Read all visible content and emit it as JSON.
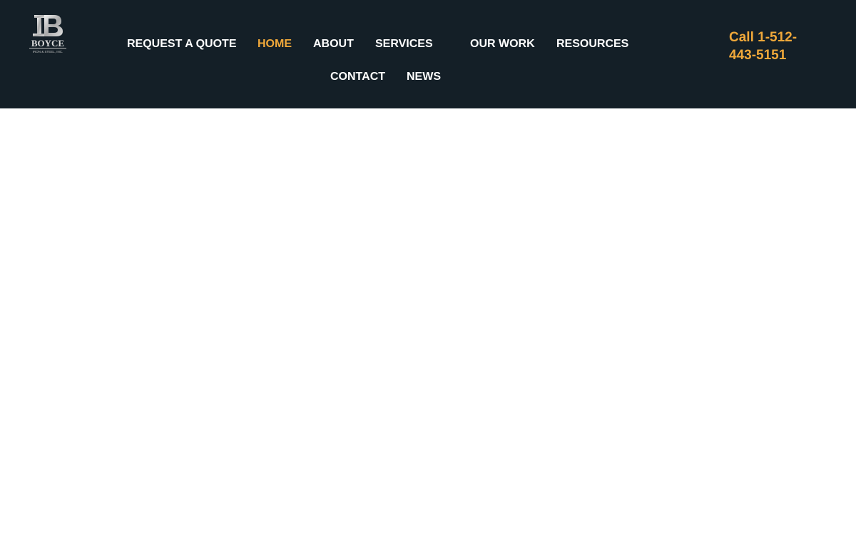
{
  "brand": {
    "name": "BOYCE",
    "tagline": "IRON & STEEL, INC.",
    "logo_icon": "boyce-b-logo-icon"
  },
  "nav": {
    "items": [
      {
        "label": "REQUEST A QUOTE",
        "active": false
      },
      {
        "label": "HOME",
        "active": true
      },
      {
        "label": "ABOUT",
        "active": false
      },
      {
        "label": "SERVICES",
        "active": false
      },
      {
        "label": "OUR WORK",
        "active": false
      },
      {
        "label": "RESOURCES",
        "active": false
      },
      {
        "label": "CONTACT",
        "active": false
      },
      {
        "label": "NEWS",
        "active": false
      }
    ]
  },
  "header": {
    "phone_label": "Call 1-512-443-5151"
  },
  "colors": {
    "header_bg": "#141f27",
    "accent": "#f0a83a",
    "nav_text": "#ffffff",
    "page_bg": "#ffffff"
  }
}
